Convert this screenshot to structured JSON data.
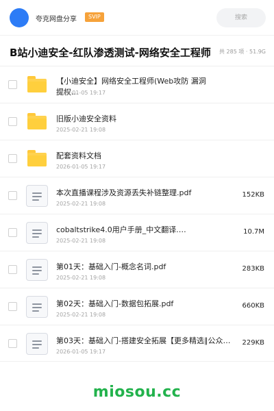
{
  "header": {
    "username": "夸克网盘分享",
    "badge": "SVIP",
    "search_label": "搜索"
  },
  "share": {
    "title": "B站小迪安全-红队渗透测试-网络安全工程师",
    "meta": "共 285 项 · 51.9G"
  },
  "files": [
    {
      "type": "folder",
      "name": "【小迪安全】网络安全工程师(Web攻防 漏洞 提权...",
      "date": "2026-01-05 19:17",
      "size": ""
    },
    {
      "type": "folder",
      "name": "旧版小迪安全资料",
      "date": "2025-02-21 19:08",
      "size": ""
    },
    {
      "type": "folder",
      "name": "配套资料文档",
      "date": "2026-01-05 19:17",
      "size": ""
    },
    {
      "type": "file",
      "name": "本次直播课程涉及资源丢失补链整理.pdf",
      "date": "2025-02-21 19:08",
      "size": "152KB"
    },
    {
      "type": "file",
      "name": "cobaltstrike4.0用户手册_中文翻译.…",
      "date": "2025-02-21 19:08",
      "size": "10.7M"
    },
    {
      "type": "file",
      "name": "第01天：基础入门-概念名词.pdf",
      "date": "2025-02-21 19:08",
      "size": "283KB"
    },
    {
      "type": "file",
      "name": "第02天：基础入门-数据包拓展.pdf",
      "date": "2025-02-21 19:08",
      "size": "660KB"
    },
    {
      "type": "file",
      "name": "第03天：基础入门-搭建安全拓展【更多精选∥公众号…",
      "date": "2026-01-05 19:17",
      "size": "229KB"
    }
  ],
  "watermark": "miosou.cc",
  "colors": {
    "accent": "#2d7cf6",
    "svip": "#f6a23a",
    "folder": "#ffd24f",
    "watermark": "#22b24c"
  }
}
